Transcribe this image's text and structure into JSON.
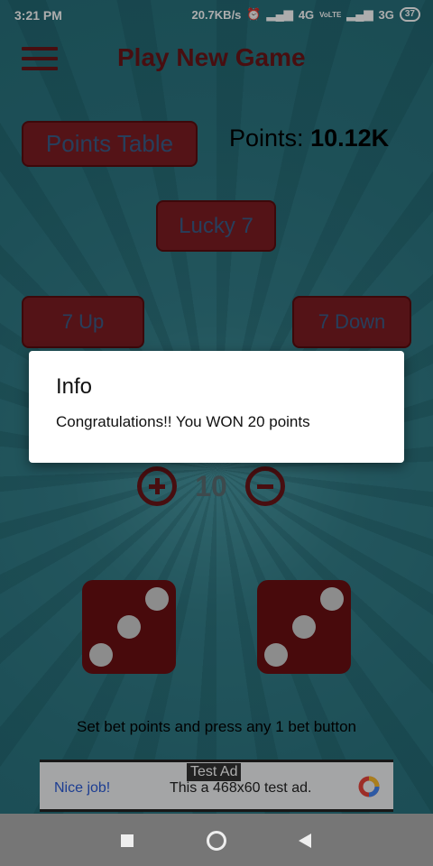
{
  "status_bar": {
    "time": "3:21 PM",
    "speed": "20.7KB/s",
    "net1": "4G",
    "volte": "VoLTE",
    "net2": "3G",
    "battery": "37"
  },
  "header": {
    "title": "Play New Game"
  },
  "buttons": {
    "points_table": "Points Table",
    "lucky7": "Lucky 7",
    "up7": "7 Up",
    "down7": "7 Down"
  },
  "points": {
    "label": "Points:",
    "value": "10.12K"
  },
  "bet": {
    "value": "10"
  },
  "dice": [
    3,
    3
  ],
  "hint": "Set bet points and press any 1 bet button",
  "ad": {
    "label": "Test Ad",
    "nice": "Nice job!",
    "text": "This a 468x60 test ad."
  },
  "dialog": {
    "title": "Info",
    "message": "Congratulations!! You WON 20 points"
  },
  "colors": {
    "primary": "#6b1518",
    "background": "#2f7c87",
    "button_text": "#3a5e88"
  }
}
